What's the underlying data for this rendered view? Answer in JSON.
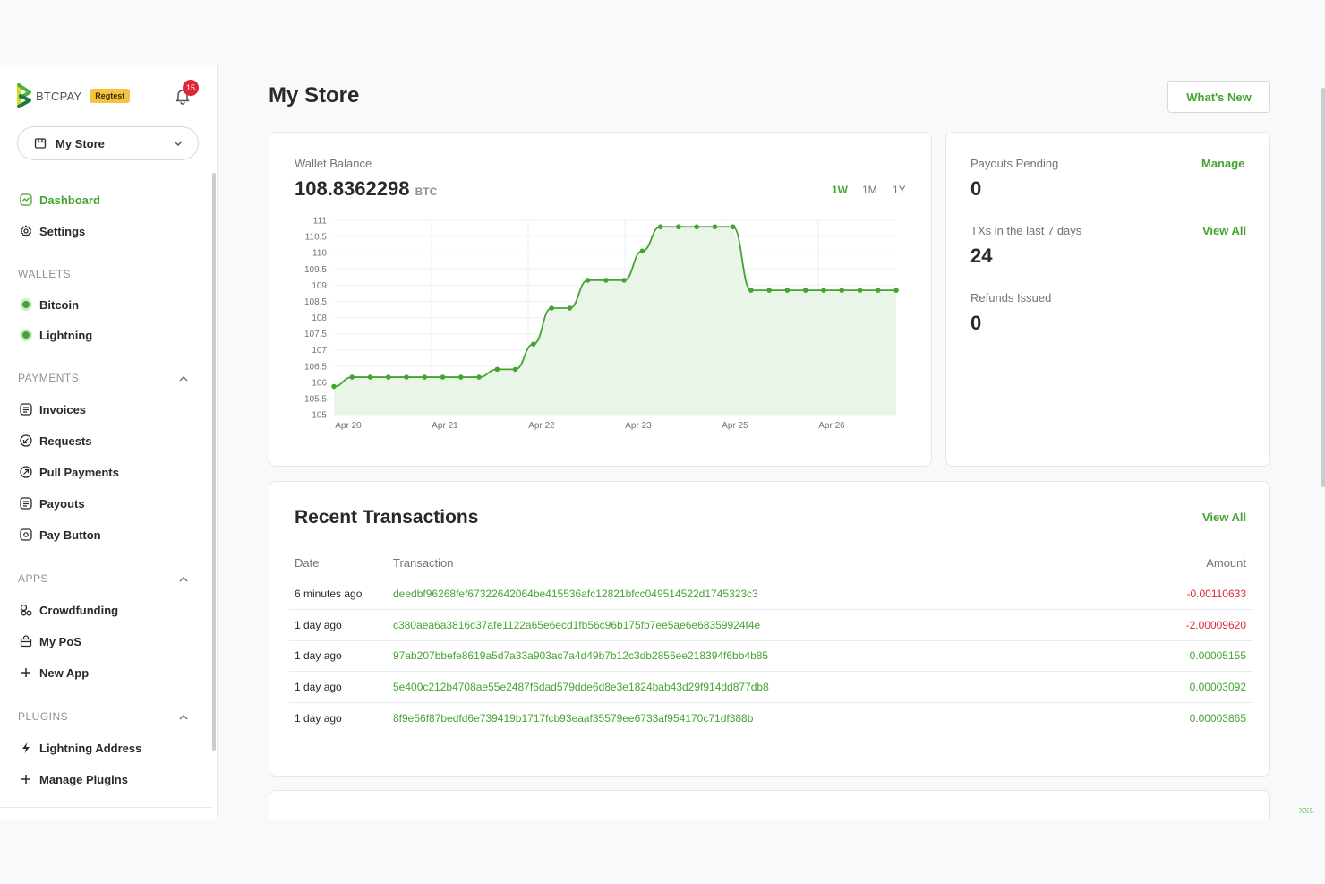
{
  "brand": {
    "name": "BTCPAY",
    "env_badge": "Regtest",
    "notification_count": "15"
  },
  "store_selector": {
    "value": "My Store"
  },
  "nav": {
    "dashboard": "Dashboard",
    "settings": "Settings",
    "wallets_header": "WALLETS",
    "bitcoin": "Bitcoin",
    "lightning": "Lightning",
    "payments_header": "PAYMENTS",
    "invoices": "Invoices",
    "requests": "Requests",
    "pull_payments": "Pull Payments",
    "payouts": "Payouts",
    "pay_button": "Pay Button",
    "apps_header": "APPS",
    "crowdfunding": "Crowdfunding",
    "my_pos": "My PoS",
    "new_app": "New App",
    "plugins_header": "PLUGINS",
    "lightning_address": "Lightning Address",
    "manage_plugins": "Manage Plugins"
  },
  "header": {
    "title": "My Store",
    "whats_new": "What's New"
  },
  "wallet": {
    "label": "Wallet Balance",
    "balance": "108.8362298",
    "unit": "BTC",
    "ranges": [
      "1W",
      "1M",
      "1Y"
    ],
    "active_range": "1W"
  },
  "stats": {
    "payouts_pending_label": "Payouts Pending",
    "payouts_pending_value": "0",
    "manage": "Manage",
    "txs_label": "TXs in the last 7 days",
    "txs_value": "24",
    "view_all": "View All",
    "refunds_label": "Refunds Issued",
    "refunds_value": "0"
  },
  "transactions": {
    "title": "Recent Transactions",
    "view_all": "View All",
    "columns": [
      "Date",
      "Transaction",
      "Amount"
    ],
    "rows": [
      {
        "date": "6 minutes ago",
        "tx": "deedbf96268fef67322642064be415536afc12821bfcc049514522d1745323c3",
        "amount": "-0.00110633",
        "sign": "neg"
      },
      {
        "date": "1 day ago",
        "tx": "c380aea6a3816c37afe1122a65e6ecd1fb56c96b175fb7ee5ae6e68359924f4e",
        "amount": "-2.00009620",
        "sign": "neg"
      },
      {
        "date": "1 day ago",
        "tx": "97ab207bbefe8619a5d7a33a903ac7a4d49b7b12c3db2856ee218394f6bb4b85",
        "amount": "0.00005155",
        "sign": "pos"
      },
      {
        "date": "1 day ago",
        "tx": "5e400c212b4708ae55e2487f6dad579dde6d8e3e1824bab43d29f914dd877db8",
        "amount": "0.00003092",
        "sign": "pos"
      },
      {
        "date": "1 day ago",
        "tx": "8f9e56f87bedfd6e739419b1717fcb93eaaf35579ee6733af954170c71df388b",
        "amount": "0.00003865",
        "sign": "pos"
      }
    ]
  },
  "colors": {
    "accent": "#44a431",
    "negative": "#e0273a",
    "badge": "#f5c242"
  },
  "corner_mark": "XXL",
  "chart_data": {
    "type": "area",
    "title": "",
    "xlabel": "",
    "ylabel": "",
    "ylim": [
      105,
      111
    ],
    "y_ticks": [
      "111",
      "110.5",
      "110",
      "109.5",
      "109",
      "108.5",
      "108",
      "107.5",
      "107",
      "106.5",
      "106",
      "105.5",
      "105"
    ],
    "x_tick_labels": [
      "Apr 20",
      "Apr 21",
      "Apr 22",
      "Apr 23",
      "Apr 25",
      "Apr 26"
    ],
    "grid": true,
    "series": [
      {
        "values": [
          105.87,
          106.16,
          106.16,
          106.16,
          106.16,
          106.16,
          106.16,
          106.16,
          106.16,
          106.4,
          106.4,
          107.18,
          108.29,
          108.29,
          109.15,
          109.15,
          109.15,
          110.05,
          110.8,
          110.8,
          110.8,
          110.8,
          110.8,
          108.84,
          108.84,
          108.84,
          108.84,
          108.84,
          108.84,
          108.84,
          108.84,
          108.84
        ]
      }
    ]
  }
}
